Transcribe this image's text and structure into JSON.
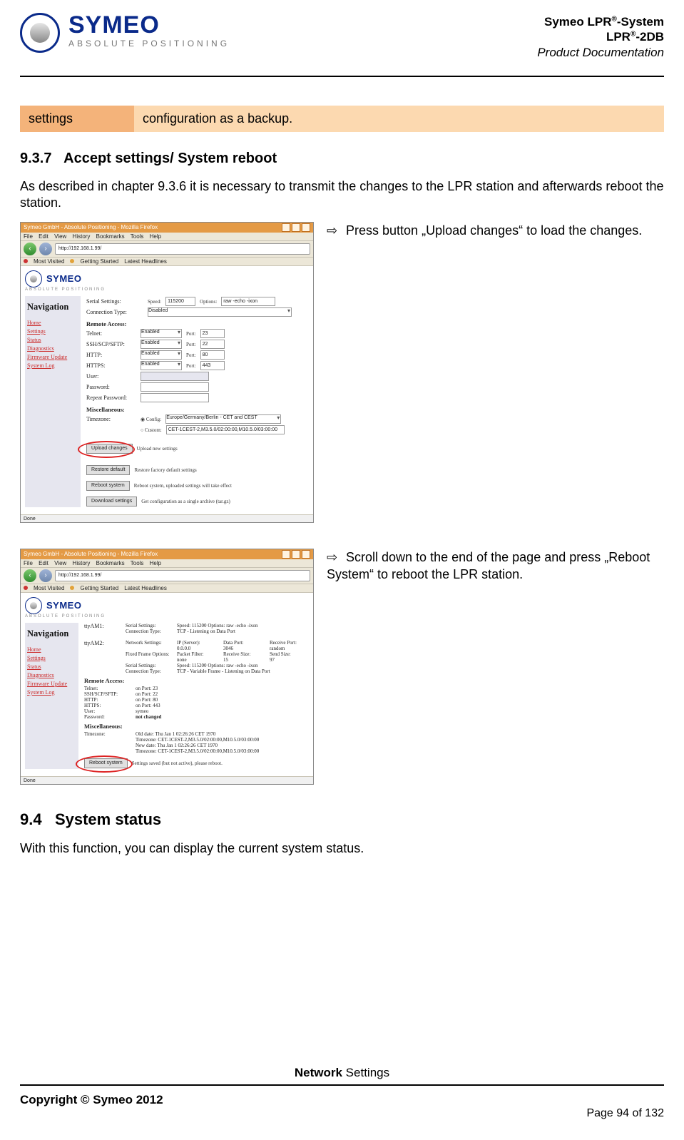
{
  "header": {
    "logo_name": "SYMEO",
    "logo_tag": "ABSOLUTE POSITIONING",
    "right_line1a": "Symeo LPR",
    "right_line1b": "-System",
    "right_line2a": "LPR",
    "right_line2b": "-2DB",
    "right_line3": "Product Documentation"
  },
  "settings_bar": {
    "left": "settings",
    "right": "configuration as a backup."
  },
  "sec937": {
    "num": "9.3.7",
    "title": "Accept settings/ System reboot",
    "intro": "As described in chapter 9.3.6 it is necessary to transmit the changes to the LPR station and afterwards reboot the station.",
    "step1": "Press  button „Upload changes“ to load the changes.",
    "step2": "Scroll down to the end of the page and press „Reboot System“ to reboot the LPR station."
  },
  "browser": {
    "title": "Symeo GmbH - Absolute Positioning - Mozilla Firefox",
    "menu": "File  Edit  View  History  Bookmarks  Tools  Help",
    "url1": "http://192.168.1.99/",
    "url2": "http://192.168.1.99/",
    "bookmarks": {
      "most": "Most Visited",
      "gs": "Getting Started",
      "lh": "Latest Headlines"
    },
    "sidebar": {
      "title": "Navigation",
      "items": [
        "Home",
        "Settings",
        "Status",
        "Diagnostics",
        "Firmware Update",
        "System Log"
      ]
    },
    "common": {
      "serial_settings": "Serial Settings:",
      "speed_lbl": "Speed:",
      "speed_val": "115200",
      "options_lbl": "Options:",
      "options_val": "raw -echo -ixon",
      "conn_type": "Connection Type:",
      "disabled": "Disabled",
      "tcp_listen": "TCP - Listening on Data Port",
      "tcp_var": "TCP - Variable Frame - Listening on Data Port",
      "ttyAM1": "ttyAM1:",
      "ttyAM2": "ttyAM2:",
      "netset": "Network Settings:",
      "ffo": "Fixed Frame Options:",
      "ff_pfilter": "Packet Filter:",
      "ff_pfilter_v": "none",
      "ff_recv": "Receive Size:",
      "ff_recv_v": "15",
      "ff_send": "Send Size:",
      "ff_send_v": "97",
      "ns_ip": "IP (Server):",
      "ns_ip_v": "0.0.0.0",
      "ns_dp": "Data Port:",
      "ns_dp_v": "3046",
      "ns_rp": "Receive Port:",
      "ns_rp_v": "random"
    },
    "remote": {
      "heading": "Remote Access:",
      "telnet": "Telnet:",
      "ssh": "SSH/SCP/SFTP:",
      "http": "HTTP:",
      "https": "HTTPS:",
      "user": "User:",
      "pass": "Password:",
      "rpass": "Repeat Password:",
      "enabled": "Enabled",
      "port": "Port:",
      "port_telnet": "23",
      "port_ssh": "22",
      "port_http": "80",
      "port_https": "443",
      "on_port23": "on Port: 23",
      "on_port22": "on Port: 22",
      "on_port80": "on Port: 80",
      "on_port443": "on Port: 443",
      "user_v": "symeo",
      "pass_v": "not changed"
    },
    "misc": {
      "heading": "Miscellaneous:",
      "timezone": "Timezone:",
      "config_opt": "Config:",
      "custom_opt": "Custom:",
      "config_val": "Europe/Germany/Berlin - CET and CEST",
      "custom_val": "CET-1CEST-2,M3.5.0/02:00:00,M10.5.0/03:00:00",
      "old_date": "Old date:  Thu Jan 1 02:26:26 CET 1970",
      "tz_line": "Timezone:  CET-1CEST-2,M3.5.0/02:00:00,M10.5.0/03:00:00",
      "new_date": "New date: Thu Jan 1 02:26:26 CET 1970",
      "tz_line2": "Timezone:  CET-1CEST-2,M3.5.0/02:00:00,M10.5.0/03:00:00"
    },
    "buttons": {
      "upload": "Upload changes",
      "upload_hint": "Upload new settings",
      "restore": "Restore default",
      "restore_hint": "Restore factory default settings",
      "reboot": "Reboot system",
      "reboot_hint": "Reboot system, uploaded settings will take effect",
      "download": "Download settings",
      "download_hint": "Get configuration as a single archive (tar.gz)",
      "reboot2_hint": "Settings saved (but not active), please reboot.",
      "done": "Done"
    }
  },
  "sec94": {
    "num": "9.4",
    "title": "System status",
    "body": "With this function, you can display the current system status."
  },
  "footer": {
    "net_bold": "Network",
    "net_rest": " Settings",
    "copyright": "Copyright © Symeo 2012",
    "page": "Page 94 of 132"
  }
}
